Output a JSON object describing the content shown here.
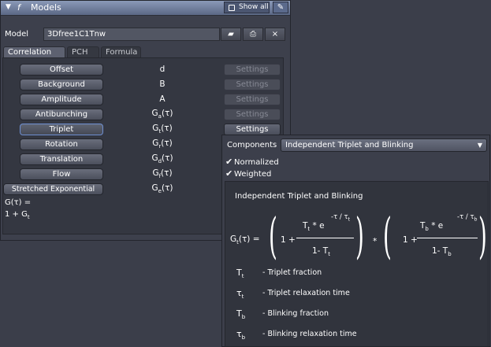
{
  "window": {
    "title": "Models",
    "f_glyph": "f",
    "collapse_glyph": "▼",
    "show_all_label": "Show all",
    "edit_glyph": "✎"
  },
  "model": {
    "label": "Model",
    "value": "3Dfree1C1Tnw",
    "open_glyph": "▰",
    "save_glyph": "⎙",
    "close_glyph": "×"
  },
  "tabs": [
    "Correlation",
    "PCH",
    "Formula"
  ],
  "params": [
    {
      "label": "Offset",
      "symbol": "d",
      "settings": "Settings"
    },
    {
      "label": "Background",
      "symbol": "B",
      "settings": "Settings"
    },
    {
      "label": "Amplitude",
      "symbol": "A",
      "settings": "Settings"
    },
    {
      "label": "Antibunching",
      "symbol": "G",
      "sub": "a",
      "arg": "(τ)",
      "settings": "Settings"
    },
    {
      "label": "Triplet",
      "symbol": "G",
      "sub": "t",
      "arg": "(τ)",
      "settings": "Settings"
    },
    {
      "label": "Rotation",
      "symbol": "G",
      "sub": "r",
      "arg": "(τ)"
    },
    {
      "label": "Translation",
      "symbol": "G",
      "sub": "d",
      "arg": "(τ)"
    },
    {
      "label": "Flow",
      "symbol": "G",
      "sub": "f",
      "arg": "(τ)"
    },
    {
      "label": "Stretched Exponential",
      "symbol": "G",
      "sub": "e",
      "arg": "(τ)"
    }
  ],
  "g_func": {
    "line1": "G(τ) =",
    "line2": "1 + G",
    "line2_sub": "t"
  },
  "components": {
    "label": "Components",
    "selected": "Independent Triplet and Blinking",
    "dropdown_glyph": "▼",
    "normalized": "Normalized",
    "weighted": "Weighted",
    "check_glyph": "✔"
  },
  "formula": {
    "title": "Independent Triplet and Blinking",
    "lhs": "G",
    "lhs_sub": "t",
    "lhs_arg": "(τ) =",
    "one_plus_a": "1 +",
    "num_a": "T",
    "num_a_sub": "t",
    "num_a_tail": " * e",
    "exp_a": "-τ / τ",
    "exp_a_sub": "t",
    "den_a": "1- T",
    "den_a_sub": "t",
    "times": "*",
    "one_plus_b": "1 +",
    "num_b": "T",
    "num_b_sub": "b",
    "num_b_tail": " * e",
    "exp_b": "-τ / τ",
    "exp_b_sub": "b",
    "den_b": "1- T",
    "den_b_sub": "b"
  },
  "legend": [
    {
      "sym": "T",
      "sub": "t",
      "desc": "- Triplet fraction"
    },
    {
      "sym": "τ",
      "sub": "t",
      "desc": "- Triplet relaxation time"
    },
    {
      "sym": "T",
      "sub": "b",
      "desc": "- Blinking fraction"
    },
    {
      "sym": "τ",
      "sub": "b",
      "desc": "- Blinking relaxation time"
    }
  ]
}
